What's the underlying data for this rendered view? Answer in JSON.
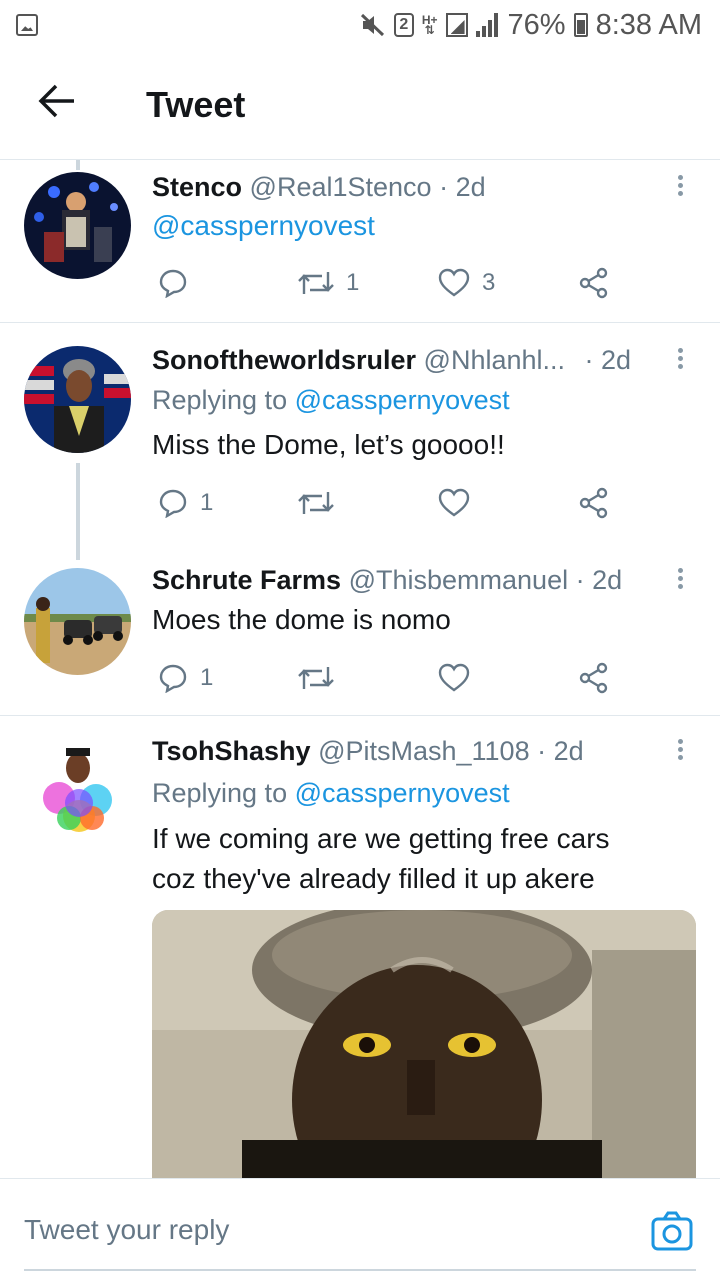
{
  "status_bar": {
    "battery_text": "76%",
    "time": "8:38 AM",
    "notification_count": "2",
    "network_type": "H+",
    "icons": [
      "gallery-icon",
      "mute-icon",
      "sim-icon",
      "signal-icon",
      "battery-icon"
    ]
  },
  "header": {
    "title": "Tweet"
  },
  "tweets": [
    {
      "name": "Stenco",
      "handle": "@Real1Stenco",
      "time": "· 2d",
      "text": "@casspernyovest",
      "retweets": "1",
      "likes": "3"
    },
    {
      "name": "Sonoftheworldsruler",
      "handle": "@Nhlanhl...",
      "time": "· 2d",
      "replying_label": "Replying to",
      "replying_to": "@casspernyovest",
      "text": "Miss the Dome, let’s goooo!!",
      "replies": "1"
    },
    {
      "name": "Schrute Farms",
      "handle": "@Thisbemmanuel",
      "time": "· 2d",
      "text": "Moes the dome is nomo",
      "replies": "1"
    },
    {
      "name": "TsohShashy",
      "handle": "@PitsMash_1108",
      "time": "· 2d",
      "replying_label": "Replying to",
      "replying_to": "@casspernyovest",
      "text_line1": "If we coming are we getting free cars",
      "text_line2": "coz they've already filled it up akere"
    }
  ],
  "reply_bar": {
    "placeholder": "Tweet your reply"
  },
  "colors": {
    "accent": "#1b95e0",
    "secondary_text": "#657786",
    "divider": "#e1e8ed"
  }
}
